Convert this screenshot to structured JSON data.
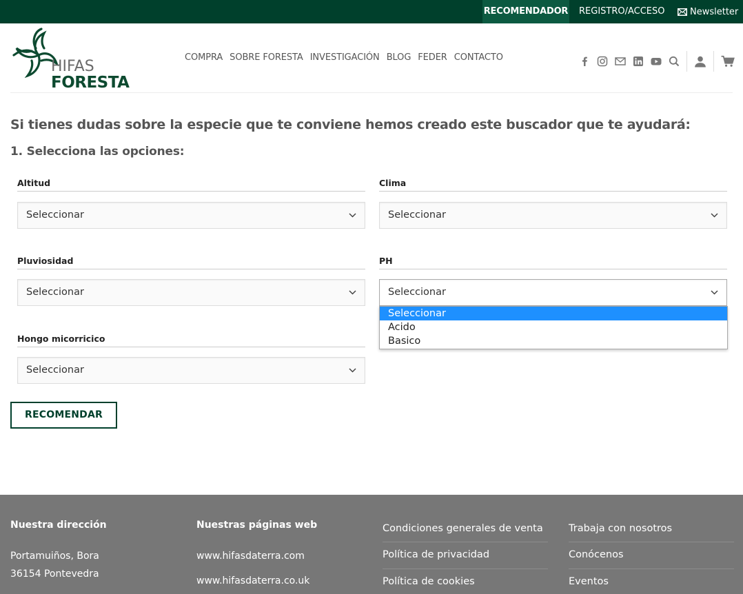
{
  "topbar": {
    "recomendador": "RECOMENDADOR",
    "registro": "REGISTRO/ACCESO",
    "newsletter": "Newsletter"
  },
  "logo": {
    "line1": "HIFAS",
    "line2": "FORESTA"
  },
  "nav": [
    "COMPRA",
    "SOBRE FORESTA",
    "INVESTIGACIÓN",
    "BLOG",
    "FEDER",
    "CONTACTO"
  ],
  "main": {
    "intro": "Si tienes dudas sobre la especie que te conviene hemos creado este buscador que te ayudará:",
    "step": "1. Selecciona las opciones:",
    "fields": {
      "altitud": {
        "label": "Altitud",
        "value": "Seleccionar"
      },
      "clima": {
        "label": "Clima",
        "value": "Seleccionar"
      },
      "pluviosidad": {
        "label": "Pluviosidad",
        "value": "Seleccionar"
      },
      "ph": {
        "label": "PH",
        "value": "Seleccionar"
      },
      "hongo": {
        "label": "Hongo micorricico",
        "value": "Seleccionar"
      }
    },
    "ph_options": [
      "Seleccionar",
      "Acido",
      "Basico"
    ],
    "button": "RECOMENDAR"
  },
  "footer": {
    "address_title": "Nuestra dirección",
    "address_line1": "Portamuiños, Bora",
    "address_line2": "36154 Pontevedra",
    "web_title": "Nuestras páginas web",
    "web1": "www.hifasdaterra.com",
    "web2": "www.hifasdaterra.co.uk",
    "links_col1": [
      "Condiciones generales de venta",
      "Política de privacidad",
      "Política de cookies"
    ],
    "links_col2": [
      "Trabaja con nosotros",
      "Conócenos",
      "Eventos"
    ]
  },
  "colors": {
    "brand": "#00402c",
    "highlight": "#1e90ff",
    "footer_bg": "#777777"
  }
}
